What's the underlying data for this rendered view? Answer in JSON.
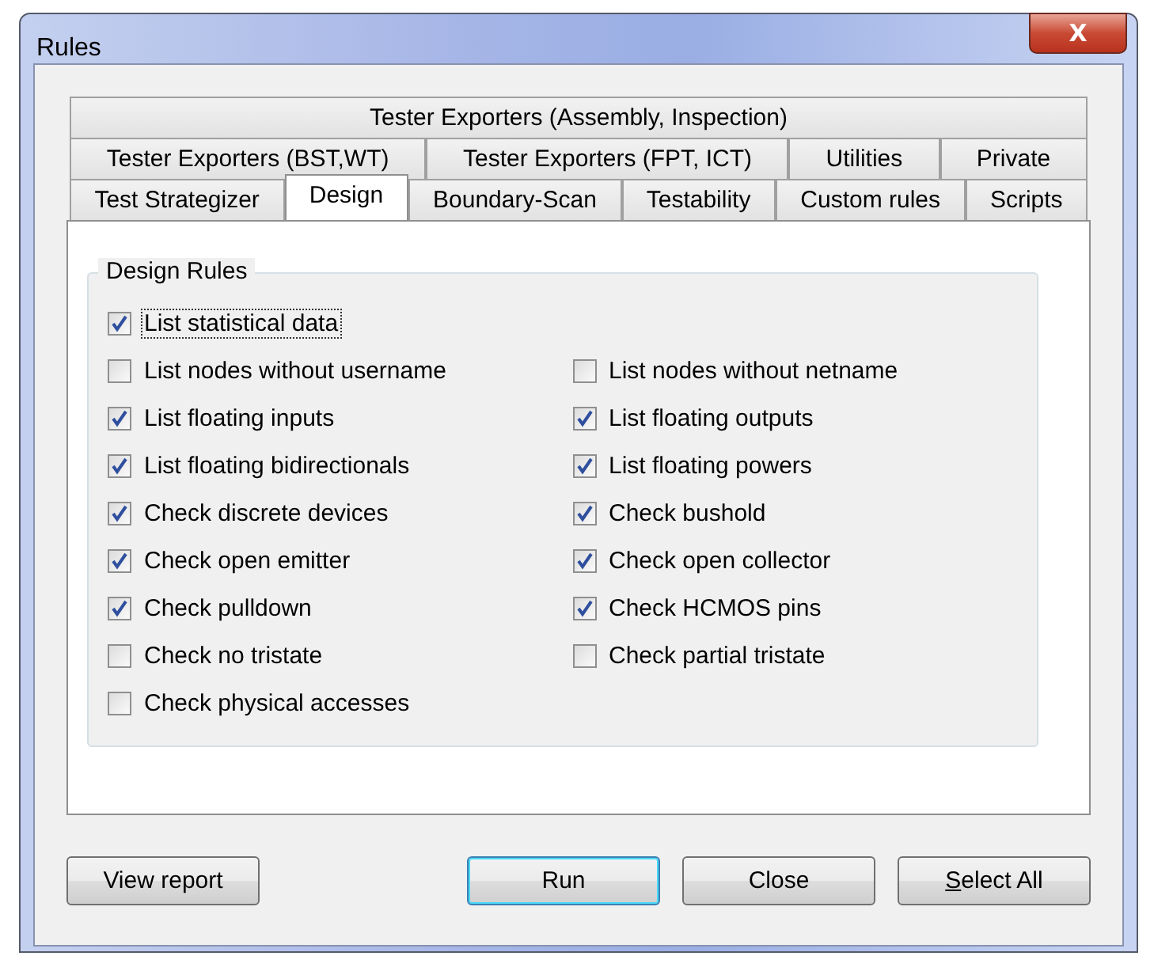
{
  "window": {
    "title": "Rules",
    "close": "X"
  },
  "tab_rows": [
    {
      "tabs": [
        {
          "label": "Tester Exporters (Assembly, Inspection)",
          "selected": false
        }
      ]
    },
    {
      "tabs": [
        {
          "label": "Tester Exporters (BST,WT)",
          "selected": false
        },
        {
          "label": "Tester Exporters (FPT, ICT)",
          "selected": false
        },
        {
          "label": "Utilities",
          "selected": false
        },
        {
          "label": "Private",
          "selected": false
        }
      ]
    },
    {
      "tabs": [
        {
          "label": "Test Strategizer",
          "selected": false
        },
        {
          "label": "Design",
          "selected": true
        },
        {
          "label": "Boundary-Scan",
          "selected": false
        },
        {
          "label": "Testability",
          "selected": false
        },
        {
          "label": "Custom rules",
          "selected": false
        },
        {
          "label": "Scripts",
          "selected": false
        }
      ]
    }
  ],
  "group": {
    "title": "Design Rules",
    "rows": [
      {
        "items": [
          {
            "label": "List statistical data",
            "checked": true,
            "focused": true
          }
        ]
      },
      {
        "items": [
          {
            "label": "List nodes without username",
            "checked": false,
            "focused": false
          },
          {
            "label": "List nodes without netname",
            "checked": false,
            "focused": false
          }
        ]
      },
      {
        "items": [
          {
            "label": "List floating inputs",
            "checked": true,
            "focused": false
          },
          {
            "label": "List floating outputs",
            "checked": true,
            "focused": false
          }
        ]
      },
      {
        "items": [
          {
            "label": "List floating bidirectionals",
            "checked": true,
            "focused": false
          },
          {
            "label": "List floating powers",
            "checked": true,
            "focused": false
          }
        ]
      },
      {
        "items": [
          {
            "label": "Check discrete devices",
            "checked": true,
            "focused": false
          },
          {
            "label": "Check bushold",
            "checked": true,
            "focused": false
          }
        ]
      },
      {
        "items": [
          {
            "label": "Check open emitter",
            "checked": true,
            "focused": false
          },
          {
            "label": "Check open collector",
            "checked": true,
            "focused": false
          }
        ]
      },
      {
        "items": [
          {
            "label": "Check pulldown",
            "checked": true,
            "focused": false
          },
          {
            "label": "Check HCMOS pins",
            "checked": true,
            "focused": false
          }
        ]
      },
      {
        "items": [
          {
            "label": "Check no tristate",
            "checked": false,
            "focused": false
          },
          {
            "label": "Check partial tristate",
            "checked": false,
            "focused": false
          }
        ]
      },
      {
        "items": [
          {
            "label": "Check physical accesses",
            "checked": false,
            "focused": false
          }
        ]
      }
    ]
  },
  "buttons": [
    {
      "label": "View report",
      "default": false,
      "mnemonic_first": false
    },
    {
      "label": "Run",
      "default": true,
      "mnemonic_first": false
    },
    {
      "label": "Close",
      "default": false,
      "mnemonic_first": false
    },
    {
      "label": "Select All",
      "default": false,
      "mnemonic_first": true
    }
  ]
}
